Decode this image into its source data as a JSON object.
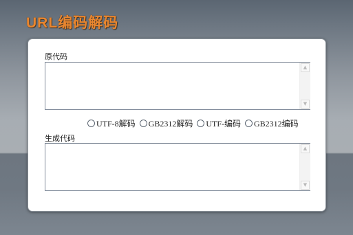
{
  "app": {
    "title": "URL编码解码"
  },
  "source": {
    "label": "原代码",
    "value": ""
  },
  "result": {
    "label": "生成代码",
    "value": ""
  },
  "options": [
    {
      "label": "UTF-8解码",
      "checked": false
    },
    {
      "label": "GB2312解码",
      "checked": false
    },
    {
      "label": "UTF-编码",
      "checked": false
    },
    {
      "label": "GB2312编码",
      "checked": false
    }
  ],
  "icons": {
    "scroll_up": "▲",
    "scroll_down": "▼"
  },
  "colors": {
    "title": "#e9862f",
    "panel_bg": "#ffffff",
    "field_border": "#7f8a99"
  }
}
